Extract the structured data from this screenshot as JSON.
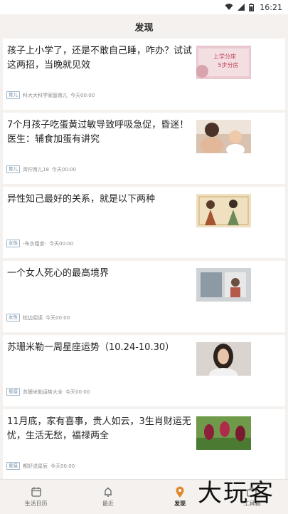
{
  "status_bar": {
    "time": "16:21"
  },
  "header": {
    "title": "发现"
  },
  "articles": [
    {
      "title": "孩子上小学了，还是不敢自己睡，咋办？试试这两招，当晚就见效",
      "tag": "育儿",
      "source": "科大大科学家庭育儿",
      "time": "今天00:00",
      "thumb_text": "上学分床\n5步分房"
    },
    {
      "title": "7个月孩子吃蛋黄过敏导致呼吸急促，昏迷！医生：辅食加蛋有讲究",
      "tag": "育儿",
      "source": "青柠育儿18",
      "time": "今天00:00",
      "thumb_text": ""
    },
    {
      "title": "异性知己最好的关系，就是以下两种",
      "tag": "女性",
      "source": "-布衣粗食-",
      "time": "今天00:00",
      "thumb_text": ""
    },
    {
      "title": "一个女人死心的最高境界",
      "tag": "女性",
      "source": "枕边阅读",
      "time": "今天00:00",
      "thumb_text": ""
    },
    {
      "title": "苏珊米勒一周星座运势（10.24-10.30）",
      "tag": "星座",
      "source": "苏珊米勒运势大全",
      "time": "今天00:00",
      "thumb_text": ""
    },
    {
      "title": "11月底，家有喜事，贵人如云，3生肖财运无忧，生活无愁，福禄两全",
      "tag": "星座",
      "source": "都好说星辰",
      "time": "今天00:00",
      "thumb_text": ""
    }
  ],
  "tabbar": {
    "tabs": [
      {
        "label": "生活日历",
        "icon": "calendar-icon"
      },
      {
        "label": "最近",
        "icon": "bell-icon"
      },
      {
        "label": "发现",
        "icon": "location-pin-icon"
      },
      {
        "label": "工具箱",
        "icon": "toolbox-icon"
      }
    ],
    "active_index": 2
  },
  "watermark": {
    "text": "大玩客"
  },
  "colors": {
    "background": "#f4f1ee",
    "card": "#ffffff",
    "tag_border": "#9fb5c8",
    "active_accent": "#e0872a"
  }
}
